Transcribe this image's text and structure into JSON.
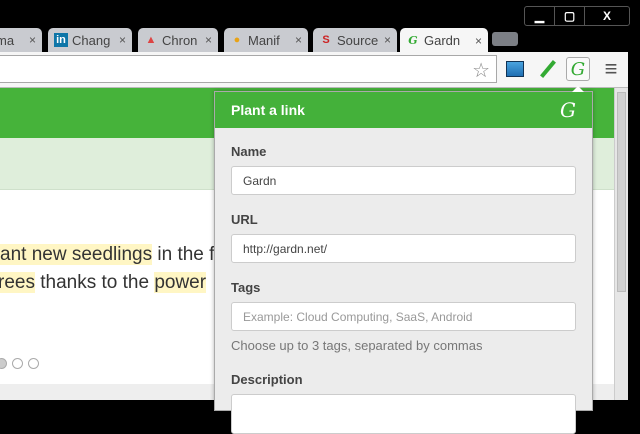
{
  "window": {
    "minimize": "▁",
    "maximize": "▢",
    "close": "X"
  },
  "tabs": [
    {
      "label": "ma",
      "icon": ""
    },
    {
      "label": "Chang",
      "icon": "in"
    },
    {
      "label": "Chron",
      "icon": "▲"
    },
    {
      "label": "Manif",
      "icon": "●"
    },
    {
      "label": "Source",
      "icon": "S"
    },
    {
      "label": "Gardn",
      "icon": "G"
    }
  ],
  "tab_close": "×",
  "toolbar": {
    "star": "☆",
    "menu": "≡",
    "gardn_icon": "G"
  },
  "page": {
    "line1_a": "ant new seedlings",
    "line1_b": " in the f",
    "line2_a": "rees",
    "line2_b": " thanks to the ",
    "line2_c": "power"
  },
  "popup": {
    "title": "Plant a link",
    "logo": "G",
    "name_label": "Name",
    "name_value": "Gardn",
    "url_label": "URL",
    "url_value": "http://gardn.net/",
    "tags_label": "Tags",
    "tags_placeholder": "Example: Cloud Computing, SaaS, Android",
    "tags_help": "Choose up to 3 tags, separated by commas",
    "description_label": "Description"
  },
  "colors": {
    "brand_green": "#46b33a"
  }
}
